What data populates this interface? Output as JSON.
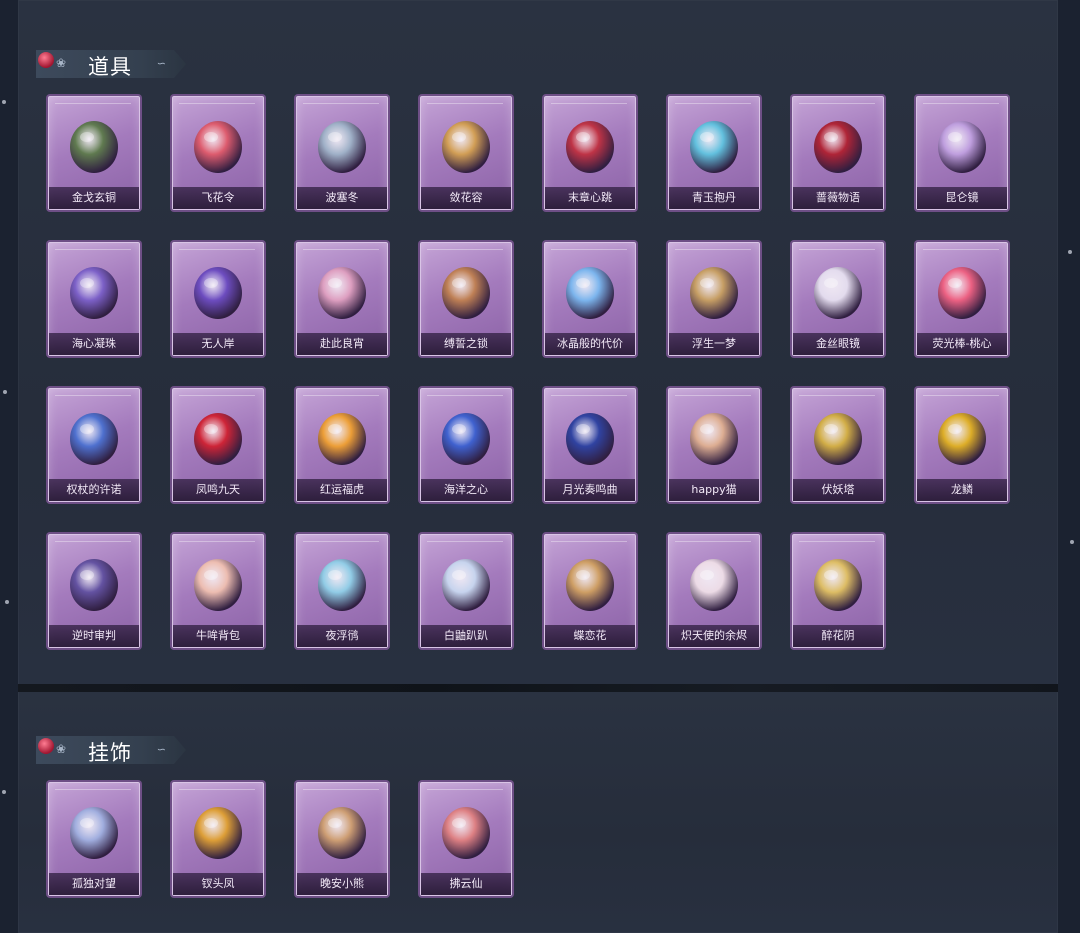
{
  "sections": [
    {
      "title": "道具",
      "items": [
        {
          "label": "金戈玄铜",
          "icon": "grenade-icon",
          "color": "#5c7a4a"
        },
        {
          "label": "飞花令",
          "icon": "flower-bouquet-icon",
          "color": "#e05a6a"
        },
        {
          "label": "波塞冬",
          "icon": "trident-icon",
          "color": "#9fb3c8"
        },
        {
          "label": "敛花容",
          "icon": "hairpin-icon",
          "color": "#d4a050"
        },
        {
          "label": "末章心跳",
          "icon": "ornate-key-icon",
          "color": "#c03040"
        },
        {
          "label": "青玉抱丹",
          "icon": "potion-bottle-icon",
          "color": "#5fc4e0"
        },
        {
          "label": "蔷薇物语",
          "icon": "first-aid-kit-icon",
          "color": "#b02030"
        },
        {
          "label": "昆仑镜",
          "icon": "magic-mirror-icon",
          "color": "#c0a0e0"
        },
        {
          "label": "海心凝珠",
          "icon": "pearl-shell-icon",
          "color": "#7a5fc8"
        },
        {
          "label": "无人岸",
          "icon": "perfume-bottle-icon",
          "color": "#6a4ac0"
        },
        {
          "label": "赴此良宵",
          "icon": "folding-fan-icon",
          "color": "#e0a0c0"
        },
        {
          "label": "缚誓之锁",
          "icon": "chain-icon",
          "color": "#c08050"
        },
        {
          "label": "冰晶般的代价",
          "icon": "ice-lotus-icon",
          "color": "#7ab8f0"
        },
        {
          "label": "浮生一梦",
          "icon": "hourglass-icon",
          "color": "#c8a060"
        },
        {
          "label": "金丝眼镜",
          "icon": "glasses-icon",
          "color": "#e6e0f0"
        },
        {
          "label": "荧光棒-桃心",
          "icon": "heart-wand-icon",
          "color": "#f06080"
        },
        {
          "label": "权杖的许诺",
          "icon": "scepter-icon",
          "color": "#4a70d0"
        },
        {
          "label": "凤鸣九天",
          "icon": "phoenix-sword-icon",
          "color": "#d02030"
        },
        {
          "label": "红运福虎",
          "icon": "tiger-icon",
          "color": "#f0a030"
        },
        {
          "label": "海洋之心",
          "icon": "heart-necklace-icon",
          "color": "#3a60d0"
        },
        {
          "label": "月光奏鸣曲",
          "icon": "piano-icon",
          "color": "#2a40a0"
        },
        {
          "label": "happy猫",
          "icon": "cat-icon",
          "color": "#e0b090"
        },
        {
          "label": "伏妖塔",
          "icon": "pagoda-icon",
          "color": "#d4b040"
        },
        {
          "label": "龙鳞",
          "icon": "golden-key-icon",
          "color": "#e0b020"
        },
        {
          "label": "逆时审判",
          "icon": "clock-amulet-icon",
          "color": "#6050a0"
        },
        {
          "label": "牛哞背包",
          "icon": "cow-backpack-icon",
          "color": "#f0c0b0"
        },
        {
          "label": "夜浮鸻",
          "icon": "jellyfish-icon",
          "color": "#90d0e8"
        },
        {
          "label": "白鼬趴趴",
          "icon": "plush-icon",
          "color": "#c8d8f0"
        },
        {
          "label": "蝶恋花",
          "icon": "flower-ring-icon",
          "color": "#d0a060"
        },
        {
          "label": "炽天使的余烬",
          "icon": "angel-doll-icon",
          "color": "#f0e0e8"
        },
        {
          "label": "醉花阴",
          "icon": "headdress-icon",
          "color": "#e0c060"
        }
      ]
    },
    {
      "title": "挂饰",
      "items": [
        {
          "label": "孤独对望",
          "icon": "charm-girl-icon",
          "color": "#a0b0e0"
        },
        {
          "label": "钗头凤",
          "icon": "charm-phoenix-icon",
          "color": "#e0a030"
        },
        {
          "label": "晚安小熊",
          "icon": "charm-bear-icon",
          "color": "#d0a070"
        },
        {
          "label": "拂云仙",
          "icon": "charm-fairy-icon",
          "color": "#e08080"
        }
      ]
    }
  ]
}
